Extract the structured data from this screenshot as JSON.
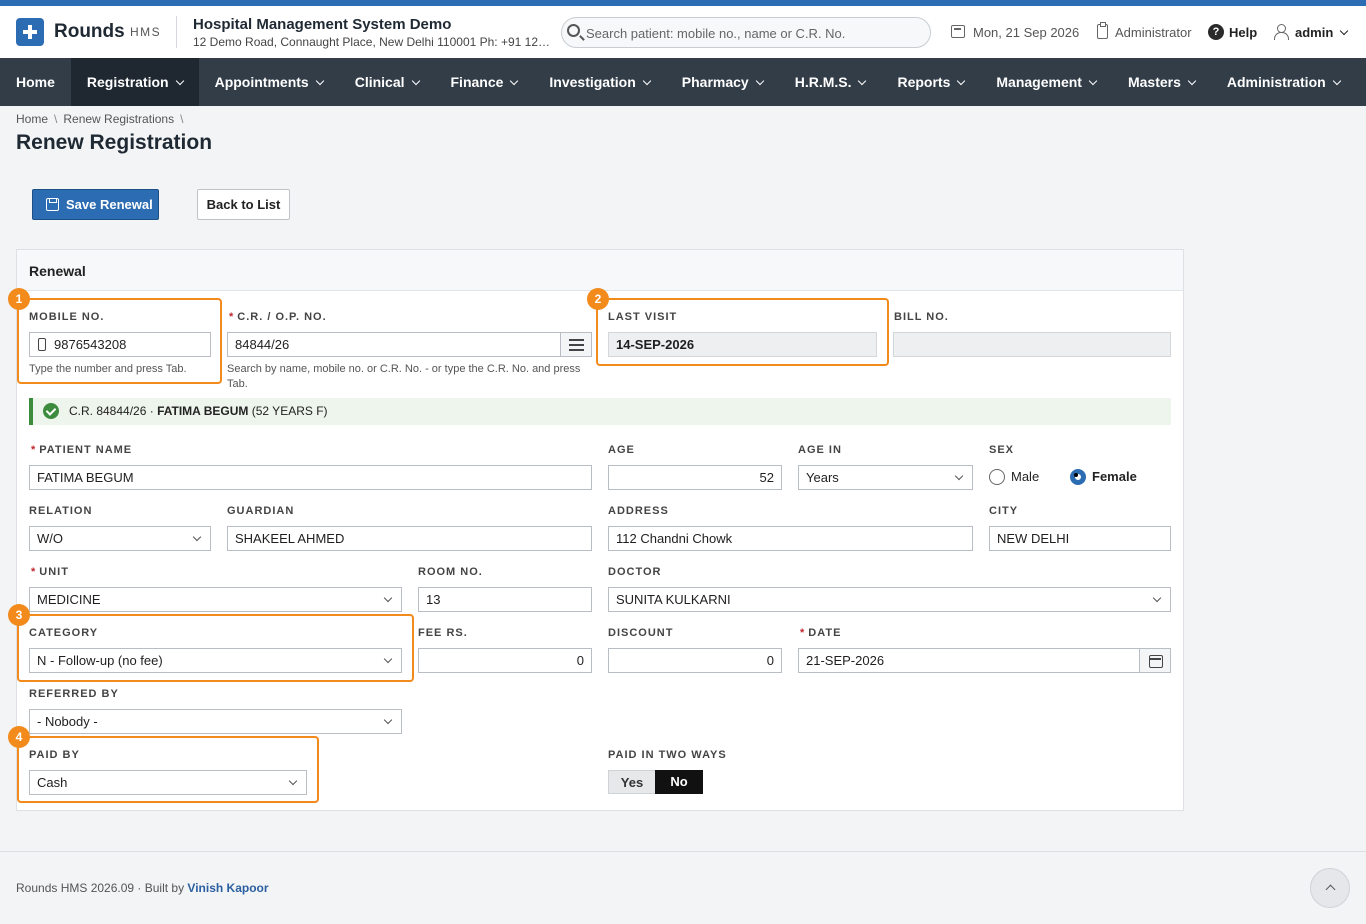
{
  "app": {
    "name": "Rounds",
    "sub": "HMS"
  },
  "org": {
    "name": "Hospital Management System Demo",
    "address": "12 Demo Road, Connaught Place, New Delhi 110001 Ph: +91 123..."
  },
  "search": {
    "placeholder": "Search patient: mobile no., name or C.R. No."
  },
  "header": {
    "date": "Mon, 21 Sep 2026",
    "role": "Administrator",
    "help": "Help",
    "user": "admin"
  },
  "nav": [
    "Home",
    "Registration",
    "Appointments",
    "Clinical",
    "Finance",
    "Investigation",
    "Pharmacy",
    "H.R.M.S.",
    "Reports",
    "Management",
    "Masters",
    "Administration"
  ],
  "breadcrumb": {
    "home": "Home",
    "section": "Renew Registrations"
  },
  "page": {
    "title": "Renew Registration",
    "save": "Save Renewal",
    "back": "Back to List"
  },
  "panel": {
    "title": "Renewal"
  },
  "badges": [
    "1",
    "2",
    "3",
    "4"
  ],
  "form": {
    "mobile": {
      "label": "MOBILE NO.",
      "value": "9876543208",
      "hint": "Type the number and press Tab."
    },
    "cr": {
      "label": "C.R. / O.P. NO.",
      "value": "84844/26",
      "hint": "Search by name, mobile no. or C.R. No. - or type the C.R. No. and press Tab."
    },
    "last_visit": {
      "label": "LAST VISIT",
      "value": "14-SEP-2026"
    },
    "bill": {
      "label": "BILL NO.",
      "value": ""
    },
    "alert": {
      "prefix": "C.R. 84844/26 · ",
      "name": "FATIMA BEGUM",
      "suffix": " (52 YEARS F)"
    },
    "patient_name": {
      "label": "PATIENT NAME",
      "value": "FATIMA BEGUM"
    },
    "age": {
      "label": "AGE",
      "value": "52"
    },
    "age_in": {
      "label": "AGE IN",
      "value": "Years"
    },
    "sex": {
      "label": "SEX",
      "male": "Male",
      "female": "Female",
      "selected": "Female"
    },
    "relation": {
      "label": "RELATION",
      "value": "W/O"
    },
    "guardian": {
      "label": "GUARDIAN",
      "value": "SHAKEEL AHMED"
    },
    "address": {
      "label": "ADDRESS",
      "value": "112 Chandni Chowk"
    },
    "city": {
      "label": "CITY",
      "value": "NEW DELHI"
    },
    "unit": {
      "label": "UNIT",
      "value": "MEDICINE"
    },
    "room": {
      "label": "ROOM NO.",
      "value": "13"
    },
    "doctor": {
      "label": "DOCTOR",
      "value": "SUNITA KULKARNI"
    },
    "category": {
      "label": "CATEGORY",
      "value": "N - Follow-up (no fee)"
    },
    "fee": {
      "label": "FEE RS.",
      "value": "0"
    },
    "discount": {
      "label": "DISCOUNT",
      "value": "0"
    },
    "date": {
      "label": "DATE",
      "value": "21-SEP-2026"
    },
    "referred_by": {
      "label": "REFERRED BY",
      "value": "- Nobody -"
    },
    "paid_by": {
      "label": "PAID BY",
      "value": "Cash"
    },
    "paid_two_ways": {
      "label": "PAID IN TWO WAYS",
      "yes": "Yes",
      "no": "No",
      "selected": "No"
    }
  },
  "footer": {
    "text": "Rounds HMS 2026.09  ·  Built by ",
    "author": "Vinish Kapoor"
  },
  "colors": {
    "brand": "#2c6cb2",
    "nav": "#323d48",
    "highlight": "#f28a1c",
    "success": "#3d8b3d"
  }
}
